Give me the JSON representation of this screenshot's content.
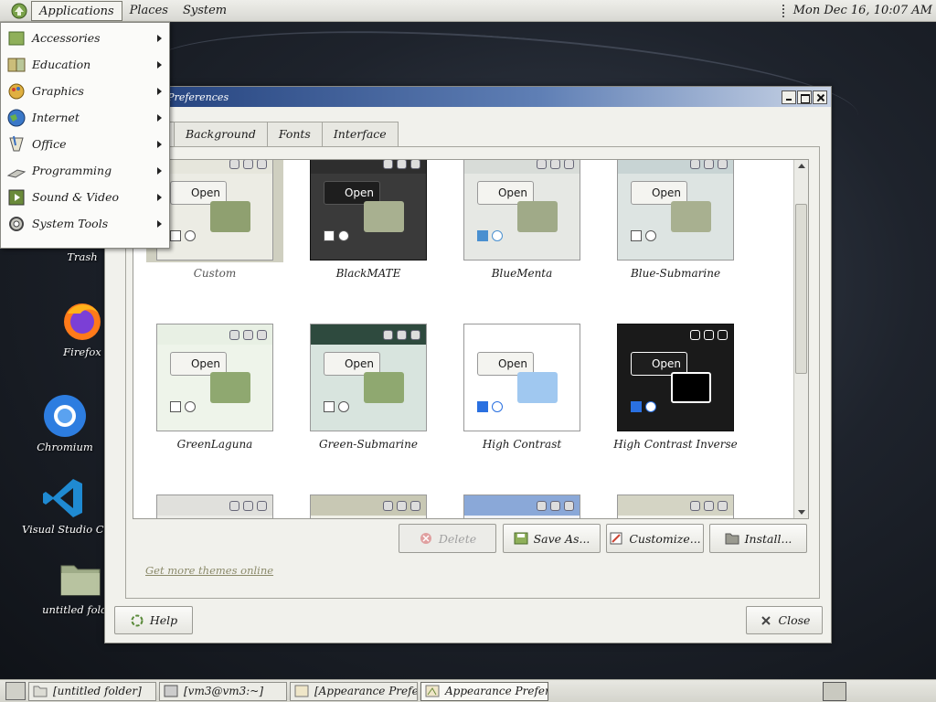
{
  "top_panel": {
    "menus": [
      "Applications",
      "Places",
      "System"
    ],
    "clock": "Mon Dec 16, 10:07 AM"
  },
  "app_menu": {
    "items": [
      {
        "label": "Accessories",
        "icon": "accessories-icon"
      },
      {
        "label": "Education",
        "icon": "education-icon"
      },
      {
        "label": "Graphics",
        "icon": "graphics-icon"
      },
      {
        "label": "Internet",
        "icon": "internet-icon"
      },
      {
        "label": "Office",
        "icon": "office-icon"
      },
      {
        "label": "Programming",
        "icon": "programming-icon"
      },
      {
        "label": "Sound & Video",
        "icon": "sound-video-icon"
      },
      {
        "label": "System Tools",
        "icon": "system-tools-icon"
      }
    ]
  },
  "desktop_icons": [
    {
      "label": "Trash",
      "icon": "trash-icon"
    },
    {
      "label": "Firefox",
      "icon": "firefox-icon"
    },
    {
      "label": "Chromium",
      "icon": "chromium-icon"
    },
    {
      "label": "Visual Studio Code",
      "icon": "vscode-icon"
    },
    {
      "label": "untitled folder",
      "icon": "folder-icon"
    }
  ],
  "window": {
    "title": "ce Preferences",
    "tabs": [
      "",
      "Background",
      "Fonts",
      "Interface"
    ],
    "themes": [
      {
        "name": "Custom",
        "selected": true
      },
      {
        "name": "BlackMATE"
      },
      {
        "name": "BlueMenta"
      },
      {
        "name": "Blue-Submarine"
      },
      {
        "name": "GreenLaguna"
      },
      {
        "name": "Green-Submarine"
      },
      {
        "name": "High Contrast"
      },
      {
        "name": "High Contrast Inverse"
      },
      {
        "name": ""
      },
      {
        "name": ""
      },
      {
        "name": ""
      },
      {
        "name": ""
      }
    ],
    "thumb_open_label": "Open",
    "buttons": {
      "delete": "Delete",
      "save_as": "Save As...",
      "customize": "Customize...",
      "install": "Install...",
      "help": "Help",
      "close": "Close"
    },
    "link": "Get more themes online"
  },
  "taskbar": {
    "tasks": [
      {
        "label": "[untitled folder]",
        "active": false
      },
      {
        "label": "[vm3@vm3:~]",
        "active": false
      },
      {
        "label": "[Appearance Prefe...",
        "active": false
      },
      {
        "label": "Appearance Prefer...",
        "active": true
      }
    ]
  }
}
